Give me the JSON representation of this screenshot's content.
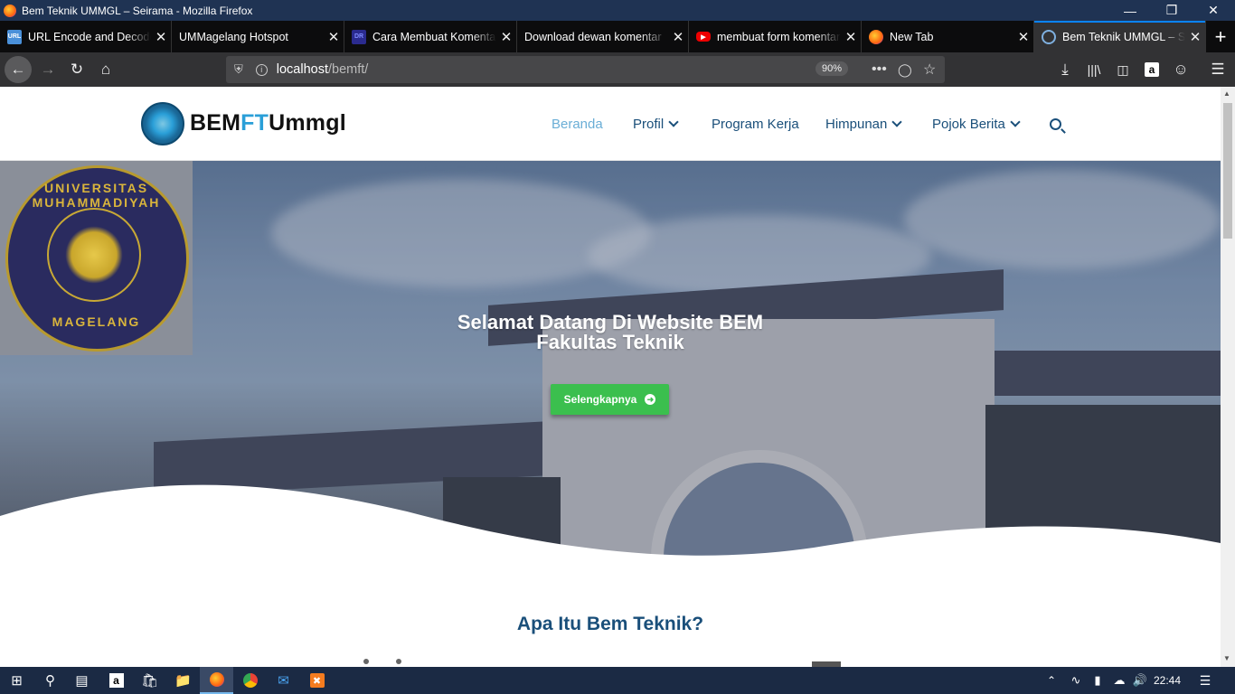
{
  "window": {
    "title": "Bem Teknik UMMGL – Seirama - Mozilla Firefox"
  },
  "tabs": [
    {
      "label": "URL Encode and Decode",
      "favicon": "URL"
    },
    {
      "label": "UMMagelang Hotspot",
      "favicon": ""
    },
    {
      "label": "Cara Membuat Komentar",
      "favicon": "DR"
    },
    {
      "label": "Download dewan komentar",
      "favicon": ""
    },
    {
      "label": "membuat form komentar",
      "favicon": "youtube"
    },
    {
      "label": "New Tab",
      "favicon": "firefox"
    },
    {
      "label": "Bem Teknik UMMGL – Seirama",
      "favicon": "site"
    }
  ],
  "urlbar": {
    "host": "localhost",
    "path": "/bemft/",
    "zoom": "90%"
  },
  "site": {
    "logo": {
      "part1": "BEM",
      "part2": "FT",
      "part3": "Ummgl"
    },
    "menu": {
      "beranda": "Beranda",
      "profil": "Profil",
      "program_kerja": "Program Kerja",
      "himpunan": "Himpunan",
      "pojok_berita": "Pojok Berita"
    },
    "seal": {
      "top_text": "UNIVERSITAS MUHAMMADIYAH",
      "bottom_text": "MAGELANG"
    },
    "hero": {
      "title_line1": "Selamat Datang Di Website BEM",
      "title_line2": "Fakultas Teknik",
      "cta_label": "Selengkapnya"
    },
    "section_title": "Apa Itu Bem Teknik?"
  },
  "taskbar": {
    "time": "22:44"
  },
  "colors": {
    "accent": "#1a4f7a",
    "active_menu": "#6aaed6",
    "cta": "#3bbf4e",
    "firefox_tab_accent": "#0a84ff"
  }
}
